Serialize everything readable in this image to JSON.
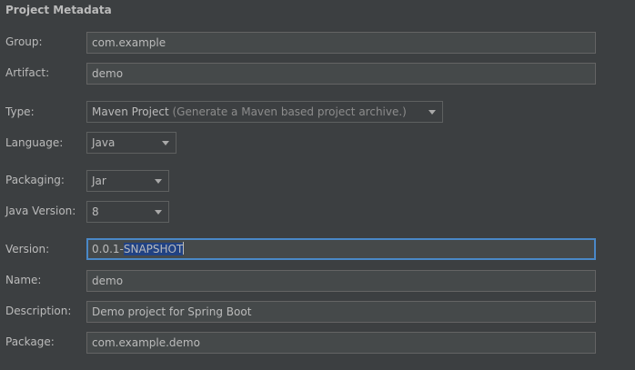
{
  "section": {
    "title": "Project Metadata"
  },
  "group": {
    "label": "Group:",
    "value": "com.example"
  },
  "artifact": {
    "label": "Artifact:",
    "value": "demo"
  },
  "type": {
    "label": "Type:",
    "value": "Maven Project",
    "hint": "(Generate a Maven based project archive.)"
  },
  "language": {
    "label": "Language:",
    "value": "Java"
  },
  "packaging": {
    "label": "Packaging:",
    "value": "Jar"
  },
  "java_version": {
    "label": "Java Version:",
    "value": "8"
  },
  "version": {
    "label": "Version:",
    "value_prefix": "0.0.1-",
    "value_selected": "SNAPSHOT"
  },
  "name": {
    "label": "Name:",
    "value": "demo"
  },
  "description": {
    "label": "Description:",
    "value": "Demo project for Spring Boot"
  },
  "package": {
    "label": "Package:",
    "value": "com.example.demo"
  },
  "colors": {
    "background": "#3c3f41",
    "field_background": "#45494a",
    "focus_border": "#4a88c7",
    "selection": "#214283",
    "text": "#bbbbbb"
  }
}
